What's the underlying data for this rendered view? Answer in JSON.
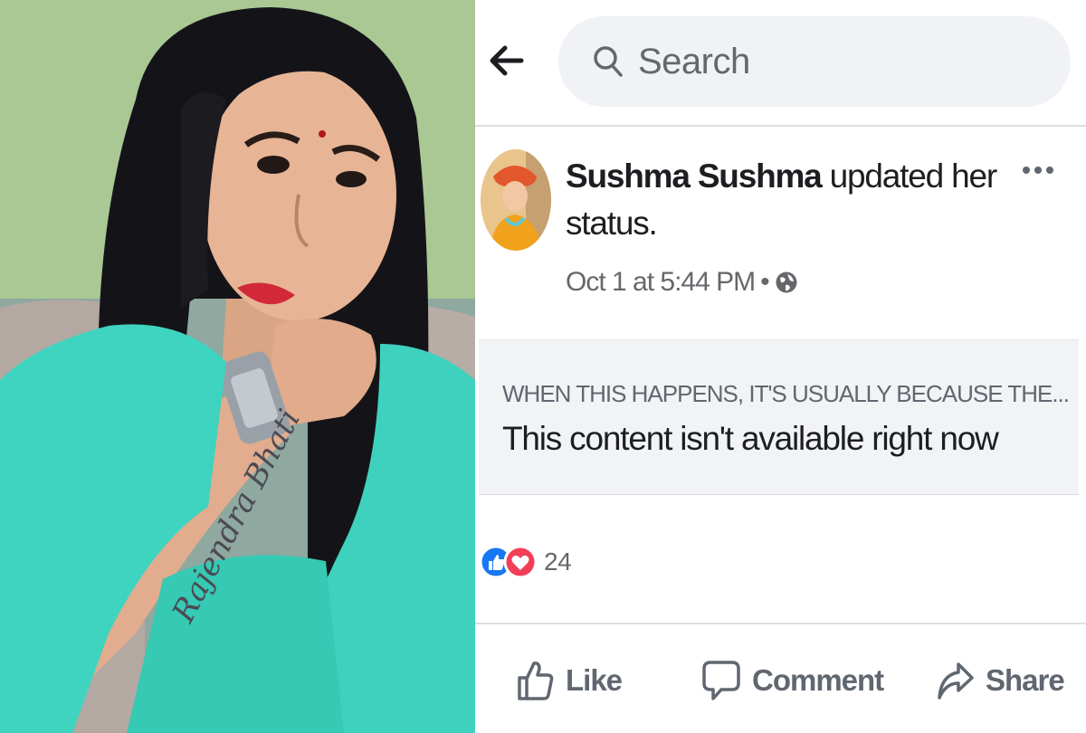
{
  "search": {
    "placeholder": "Search"
  },
  "post": {
    "author_name": "Sushma Sushma",
    "action_text": "updated her status.",
    "timestamp": "Oct 1 at 5:44 PM",
    "separator": "•",
    "privacy_icon": "globe-icon"
  },
  "unavailable": {
    "kicker": "WHEN THIS HAPPENS, IT'S USUALLY BECAUSE THE...",
    "title": "This content isn't available right now"
  },
  "reactions": {
    "icons": [
      "like-reaction-icon",
      "love-reaction-icon"
    ],
    "count": "24"
  },
  "actions": {
    "like_label": "Like",
    "comment_label": "Comment",
    "share_label": "Share"
  },
  "colors": {
    "like_blue": "#1877f2",
    "love_red": "#f33e58",
    "muted_text": "#65676b",
    "search_bg": "#f0f2f5",
    "panel_bg": "#f2f3f5"
  }
}
